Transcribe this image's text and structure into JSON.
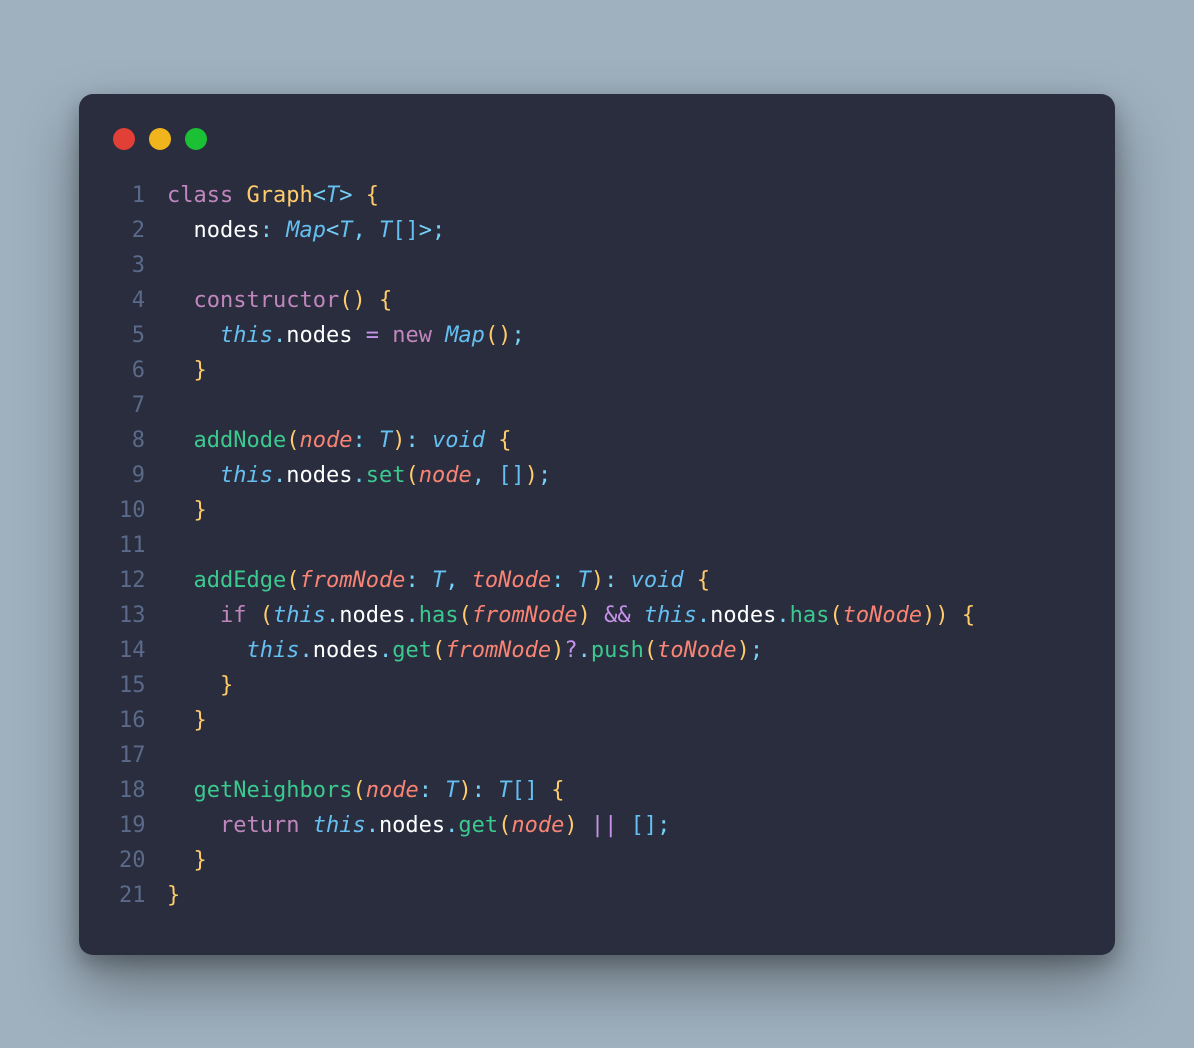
{
  "traffic_lights": {
    "close": "#e23f36",
    "minimize": "#f0b41c",
    "zoom": "#1bc034"
  },
  "line_numbers": [
    "1",
    "2",
    "3",
    "4",
    "5",
    "6",
    "7",
    "8",
    "9",
    "10",
    "11",
    "12",
    "13",
    "14",
    "15",
    "16",
    "17",
    "18",
    "19",
    "20",
    "21"
  ],
  "code": {
    "l1": {
      "kw_class": "class ",
      "name": "Graph",
      "lt": "<",
      "T": "T",
      "gt": ">",
      "sp": " ",
      "ob": "{"
    },
    "l2": {
      "indent": "  ",
      "nodes": "nodes",
      "colon": ": ",
      "Map": "Map",
      "lt": "<",
      "T1": "T",
      "comma": ", ",
      "T2": "T",
      "arr": "[]",
      "gt": ">",
      "semi": ";"
    },
    "l3": {
      "blank": ""
    },
    "l4": {
      "indent": "  ",
      "ctor": "constructor",
      "parens": "()",
      "sp": " ",
      "ob": "{"
    },
    "l5": {
      "indent": "    ",
      "this": "this",
      "dot": ".",
      "nodes": "nodes ",
      "eq": "=",
      "sp": " ",
      "new": "new ",
      "Map": "Map",
      "parens": "()",
      "semi": ";"
    },
    "l6": {
      "indent": "  ",
      "cb": "}"
    },
    "l7": {
      "blank": ""
    },
    "l8": {
      "indent": "  ",
      "fn": "addNode",
      "op": "(",
      "p": "node",
      "colon": ": ",
      "T": "T",
      "cp": ")",
      "colon2": ": ",
      "void": "void",
      "sp": " ",
      "ob": "{"
    },
    "l9": {
      "indent": "    ",
      "this": "this",
      "dot1": ".",
      "nodes": "nodes",
      "dot2": ".",
      "set": "set",
      "op": "(",
      "p": "node",
      "comma": ", ",
      "arr": "[]",
      "cp": ")",
      "semi": ";"
    },
    "l10": {
      "indent": "  ",
      "cb": "}"
    },
    "l11": {
      "blank": ""
    },
    "l12": {
      "indent": "  ",
      "fn": "addEdge",
      "op": "(",
      "p1": "fromNode",
      "c1": ": ",
      "T1": "T",
      "comma": ", ",
      "p2": "toNode",
      "c2": ": ",
      "T2": "T",
      "cp": ")",
      "c3": ": ",
      "void": "void",
      "sp": " ",
      "ob": "{"
    },
    "l13": {
      "indent": "    ",
      "if": "if ",
      "op": "(",
      "this1": "this",
      "d1": ".",
      "nodes1": "nodes",
      "d2": ".",
      "has1": "has",
      "op2": "(",
      "p1": "fromNode",
      "cp2": ")",
      "sp1": " ",
      "and": "&&",
      "sp2": " ",
      "this2": "this",
      "d3": ".",
      "nodes2": "nodes",
      "d4": ".",
      "has2": "has",
      "op3": "(",
      "p2": "toNode",
      "cp3": ")",
      "cp": ")",
      "sp3": " ",
      "ob": "{"
    },
    "l14": {
      "indent": "      ",
      "this": "this",
      "d1": ".",
      "nodes": "nodes",
      "d2": ".",
      "get": "get",
      "op": "(",
      "p1": "fromNode",
      "cp": ")",
      "q": "?",
      "d3": ".",
      "push": "push",
      "op2": "(",
      "p2": "toNode",
      "cp2": ")",
      "semi": ";"
    },
    "l15": {
      "indent": "    ",
      "cb": "}"
    },
    "l16": {
      "indent": "  ",
      "cb": "}"
    },
    "l17": {
      "blank": ""
    },
    "l18": {
      "indent": "  ",
      "fn": "getNeighbors",
      "op": "(",
      "p": "node",
      "colon": ": ",
      "T": "T",
      "cp": ")",
      "colon2": ": ",
      "T2": "T",
      "arr": "[]",
      "sp": " ",
      "ob": "{"
    },
    "l19": {
      "indent": "    ",
      "ret": "return ",
      "this": "this",
      "d1": ".",
      "nodes": "nodes",
      "d2": ".",
      "get": "get",
      "op": "(",
      "p": "node",
      "cp": ")",
      "sp1": " ",
      "or": "||",
      "sp2": " ",
      "arr": "[]",
      "semi": ";"
    },
    "l20": {
      "indent": "  ",
      "cb": "}"
    },
    "l21": {
      "cb": "}"
    }
  }
}
